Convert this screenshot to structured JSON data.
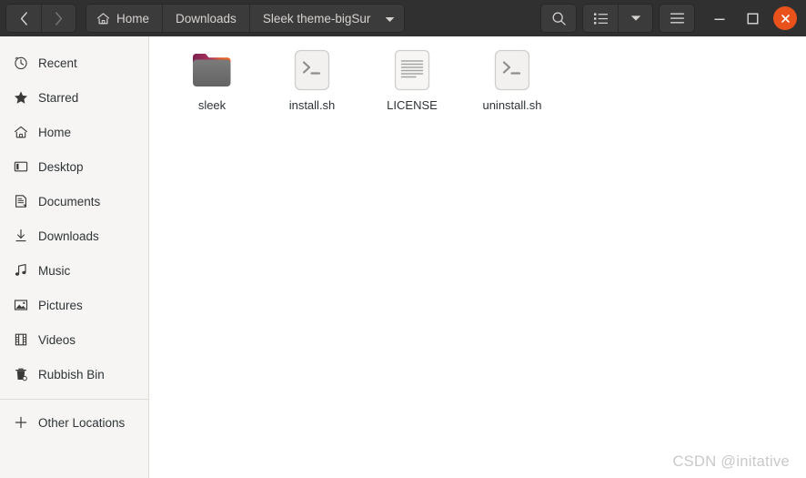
{
  "window": {
    "title": "Sleek theme-bigSur"
  },
  "header": {
    "nav": {
      "back_icon": "chevron-left-icon",
      "forward_icon": "chevron-right-icon",
      "back_enabled": true,
      "forward_enabled": false
    },
    "breadcrumbs": [
      {
        "label": "Home",
        "icon": "home-icon",
        "current": false
      },
      {
        "label": "Downloads",
        "icon": "",
        "current": false
      },
      {
        "label": "Sleek theme-bigSur",
        "icon": "",
        "current": true
      }
    ],
    "breadcrumb_caret_icon": "caret-down-icon",
    "tools": [
      {
        "name": "search-button",
        "icon": "search-icon"
      },
      {
        "name": "view-list-button",
        "icon": "list-view-icon"
      },
      {
        "name": "view-options-button",
        "icon": "caret-down-icon"
      },
      {
        "name": "main-menu-button",
        "icon": "hamburger-icon"
      }
    ],
    "window_controls": [
      {
        "name": "minimize-button",
        "icon": "minimize-icon",
        "glyph": "–"
      },
      {
        "name": "maximize-button",
        "icon": "maximize-icon",
        "glyph": "□"
      },
      {
        "name": "close-button",
        "icon": "close-icon",
        "glyph": "×",
        "color": "#e9521b"
      }
    ]
  },
  "sidebar": {
    "items": [
      {
        "label": "Recent",
        "icon": "clock-icon"
      },
      {
        "label": "Starred",
        "icon": "star-icon"
      },
      {
        "label": "Home",
        "icon": "home-icon"
      },
      {
        "label": "Desktop",
        "icon": "desktop-icon"
      },
      {
        "label": "Documents",
        "icon": "documents-icon"
      },
      {
        "label": "Downloads",
        "icon": "download-icon"
      },
      {
        "label": "Music",
        "icon": "music-note-icon"
      },
      {
        "label": "Pictures",
        "icon": "picture-icon"
      },
      {
        "label": "Videos",
        "icon": "film-icon"
      },
      {
        "label": "Rubbish Bin",
        "icon": "trash-icon"
      }
    ],
    "footer": {
      "label": "Other Locations",
      "icon": "plus-icon"
    }
  },
  "content": {
    "files": [
      {
        "name": "sleek",
        "type": "folder",
        "icon": "folder-icon"
      },
      {
        "name": "install.sh",
        "type": "script",
        "icon": "terminal-script-icon"
      },
      {
        "name": "LICENSE",
        "type": "text",
        "icon": "text-document-icon"
      },
      {
        "name": "uninstall.sh",
        "type": "script",
        "icon": "terminal-script-icon"
      }
    ]
  },
  "watermark": {
    "text": "CSDN @initative"
  },
  "colors": {
    "headerbar": "#303030",
    "header_button": "#3b3b3b",
    "header_text": "#d6d2d0",
    "sidebar_bg": "#f6f5f4",
    "content_bg": "#ffffff",
    "text": "#2e3436",
    "close_accent": "#e9521b",
    "folder_gradient_start": "#8e2e5a",
    "folder_gradient_end": "#f26322",
    "folder_body": "#6e6e6e"
  }
}
